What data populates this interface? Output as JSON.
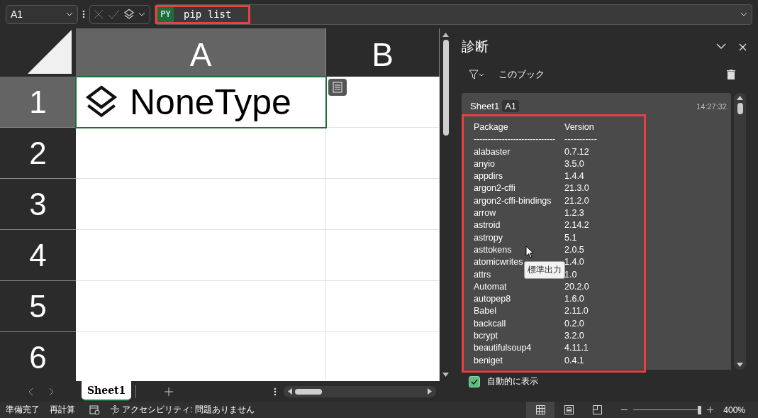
{
  "name_box": {
    "value": "A1"
  },
  "formula_bar": {
    "badge": "PY",
    "formula": "pip list",
    "highlighted": true
  },
  "columns": [
    {
      "label": "A",
      "selected": true
    },
    {
      "label": "B",
      "selected": false
    }
  ],
  "rows": [
    {
      "label": "1",
      "selected": true
    },
    {
      "label": "2",
      "selected": false
    },
    {
      "label": "3",
      "selected": false
    },
    {
      "label": "4",
      "selected": false
    },
    {
      "label": "5",
      "selected": false
    },
    {
      "label": "6",
      "selected": false
    }
  ],
  "active_cell": {
    "value": "NoneType",
    "kind": "python_object"
  },
  "sheet_tabs": [
    {
      "label": "Sheet1",
      "selected": true
    }
  ],
  "panel": {
    "title": "診断",
    "filter": "このブック",
    "entry": {
      "sheet": "Sheet1",
      "cell": "A1",
      "time": "14:27:32",
      "highlighted": true,
      "header": {
        "name": "Package",
        "version": "Version"
      },
      "rule": {
        "name": "-----------------------------",
        "version": "-----------"
      },
      "packages": [
        {
          "name": "alabaster",
          "version": "0.7.12"
        },
        {
          "name": "anyio",
          "version": "3.5.0"
        },
        {
          "name": "appdirs",
          "version": "1.4.4"
        },
        {
          "name": "argon2-cffi",
          "version": "21.3.0"
        },
        {
          "name": "argon2-cffi-bindings",
          "version": "21.2.0"
        },
        {
          "name": "arrow",
          "version": "1.2.3"
        },
        {
          "name": "astroid",
          "version": "2.14.2"
        },
        {
          "name": "astropy",
          "version": "5.1"
        },
        {
          "name": "asttokens",
          "version": "2.0.5"
        },
        {
          "name": "atomicwrites",
          "version": "1.4.0"
        },
        {
          "name": "attrs",
          "version": "1.0"
        },
        {
          "name": "Automat",
          "version": "20.2.0"
        },
        {
          "name": "autopep8",
          "version": "1.6.0"
        },
        {
          "name": "Babel",
          "version": "2.11.0"
        },
        {
          "name": "backcall",
          "version": "0.2.0"
        },
        {
          "name": "bcrypt",
          "version": "3.2.0"
        },
        {
          "name": "beautifulsoup4",
          "version": "4.11.1"
        },
        {
          "name": "beniget",
          "version": "0.4.1"
        }
      ]
    },
    "tooltip": "標準出力",
    "auto_show": {
      "label": "自動的に表示",
      "checked": true
    }
  },
  "status_bar": {
    "items": [
      "準備完了",
      "再計算"
    ],
    "accessibility": "アクセシビリティ: 問題ありません",
    "views": [
      {
        "kind": "normal",
        "selected": true
      },
      {
        "kind": "page_layout",
        "selected": false
      },
      {
        "kind": "page_break",
        "selected": false
      }
    ],
    "zoom": {
      "level": 0.97,
      "reading": "400%"
    }
  }
}
